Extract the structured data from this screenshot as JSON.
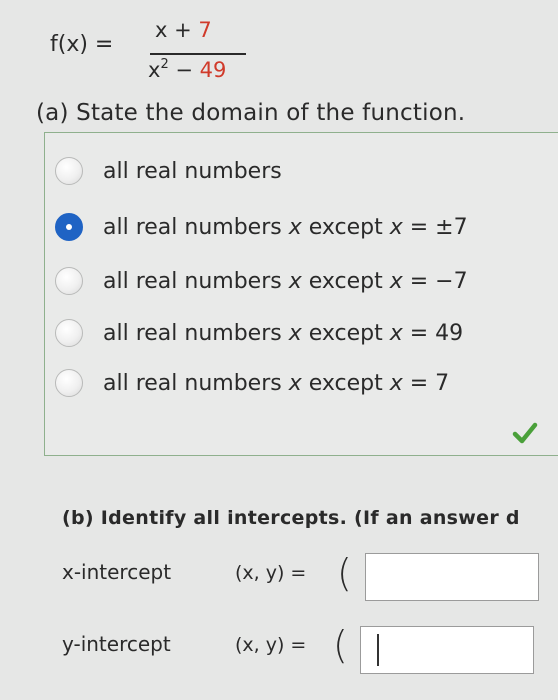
{
  "function": {
    "label": "f(x) =",
    "numerator_x": "x + ",
    "numerator_const": "7",
    "denominator_x": "x",
    "denominator_exp": "2",
    "denominator_op": " − ",
    "denominator_const": "49"
  },
  "part_a": {
    "question": "(a) State the domain of the function.",
    "options": [
      {
        "text_before": "all real numbers",
        "var": "",
        "text_after": "",
        "selected": false
      },
      {
        "text_before": "all real numbers ",
        "var": "x",
        "text_after": " except ",
        "var2": "x",
        "tail": " = ±7",
        "selected": true
      },
      {
        "text_before": "all real numbers ",
        "var": "x",
        "text_after": " except ",
        "var2": "x",
        "tail": " = −7",
        "selected": false
      },
      {
        "text_before": "all real numbers ",
        "var": "x",
        "text_after": " except ",
        "var2": "x",
        "tail": " = 49",
        "selected": false
      },
      {
        "text_before": "all real numbers ",
        "var": "x",
        "text_after": " except ",
        "var2": "x",
        "tail": " = 7",
        "selected": false
      }
    ],
    "status_icon": "checkmark-icon"
  },
  "part_b": {
    "question": "(b) Identify all intercepts. (If an answer d",
    "x_intercept": {
      "label": "x-intercept",
      "coord": "(x, y) =",
      "value": ""
    },
    "y_intercept": {
      "label": "y-intercept",
      "coord": "(x, y) =",
      "value": ""
    }
  },
  "colors": {
    "accent_red": "#d03a2a",
    "selected_blue": "#1f63c4",
    "check_green": "#4aa03a"
  }
}
